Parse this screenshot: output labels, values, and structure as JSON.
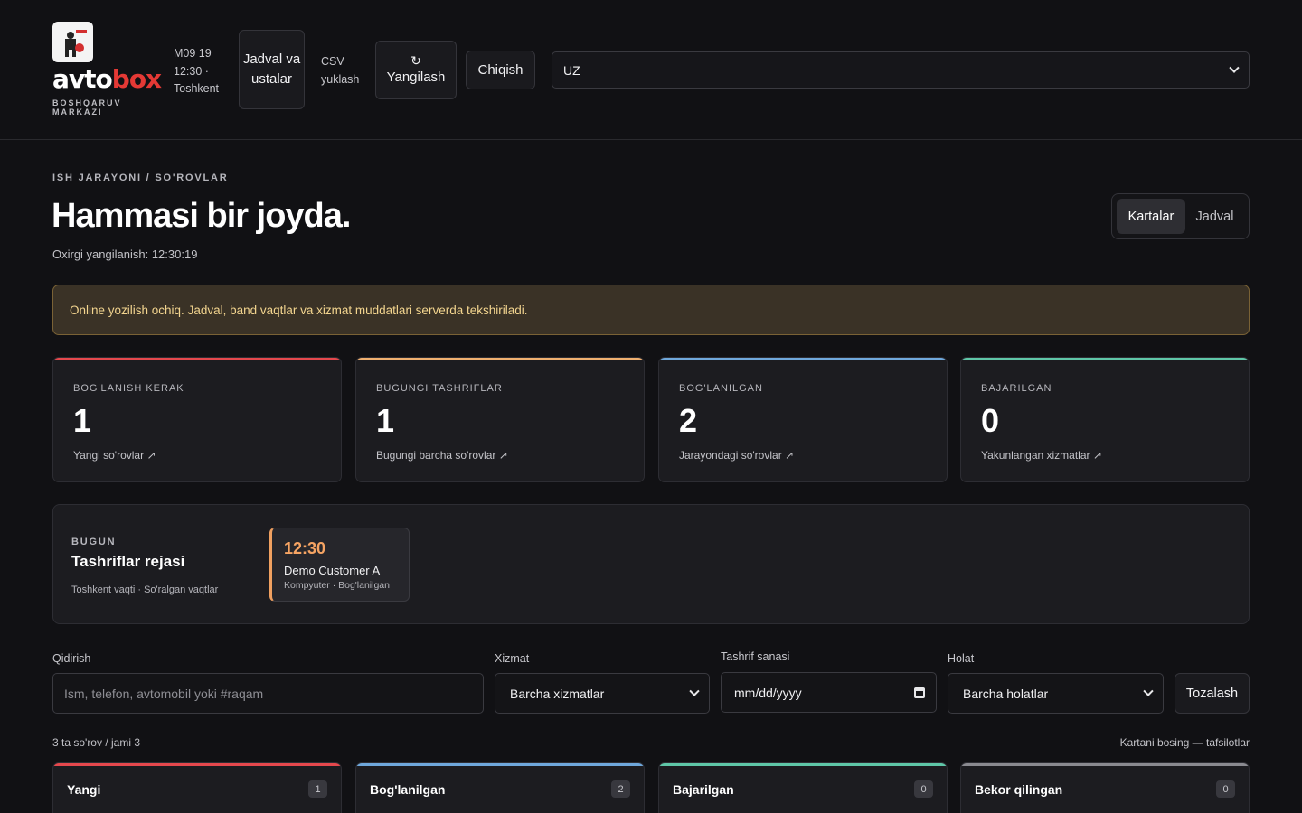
{
  "header": {
    "logo": {
      "word_a": "avto",
      "word_b": "box",
      "subtitle": "BOSHQARUV MARKAZI",
      "image_text": "avtobox"
    },
    "datetime": "M09 19 12:30 · Toshkent",
    "schedule_button": "Jadval va ustalar",
    "csv_link": "CSV yuklash",
    "refresh_icon": "↻",
    "refresh_label": "Yangilash",
    "logout_label": "Chiqish",
    "language_value": "UZ"
  },
  "hero": {
    "breadcrumb": "ISH JARAYONI / SO'ROVLAR",
    "title": "Hammasi bir joyda.",
    "last_updated": "Oxirgi yangilanish: 12:30:19",
    "view_toggle": {
      "cards": "Kartalar",
      "table": "Jadval",
      "active": "Kartalar"
    }
  },
  "notice": "Online yozilish ochiq. Jadval, band vaqtlar va xizmat muddatlari serverda tekshiriladi.",
  "stats": [
    {
      "label": "BOG'LANISH KERAK",
      "value": "1",
      "link": "Yangi so'rovlar ↗",
      "color": "#e5484d"
    },
    {
      "label": "BUGUNGI TASHRIFLAR",
      "value": "1",
      "link": "Bugungi barcha so'rovlar ↗",
      "color": "#f0b070"
    },
    {
      "label": "BOG'LANILGAN",
      "value": "2",
      "link": "Jarayondagi so'rovlar ↗",
      "color": "#6fa8dc"
    },
    {
      "label": "BAJARILGAN",
      "value": "0",
      "link": "Yakunlangan xizmatlar ↗",
      "color": "#5fc7a8"
    }
  ],
  "schedule": {
    "kicker": "BUGUN",
    "title": "Tashriflar rejasi",
    "subtitle": "Toshkent vaqti · So'ralgan vaqtlar",
    "visits": [
      {
        "time": "12:30",
        "name": "Demo Customer A",
        "meta": "Kompyuter · Bog'lanilgan"
      }
    ]
  },
  "filters": {
    "search_label": "Qidirish",
    "search_placeholder": "Ism, telefon, avtomobil yoki #raqam",
    "service_label": "Xizmat",
    "service_value": "Barcha xizmatlar",
    "date_label": "Tashrif sanasi",
    "date_value": "mm/dd/yyyy",
    "status_label": "Holat",
    "status_value": "Barcha holatlar",
    "clear_label": "Tozalash"
  },
  "results": {
    "count_text": "3 ta so'rov / jami 3",
    "hint_text": "Kartani bosing — tafsilotlar"
  },
  "columns": [
    {
      "title": "Yangi",
      "count": "1",
      "color": "#e5484d"
    },
    {
      "title": "Bog'lanilgan",
      "count": "2",
      "color": "#6fa8dc"
    },
    {
      "title": "Bajarilgan",
      "count": "0",
      "color": "#5fc7a8"
    },
    {
      "title": "Bekor qilingan",
      "count": "0",
      "color": "#8a8a90"
    }
  ]
}
